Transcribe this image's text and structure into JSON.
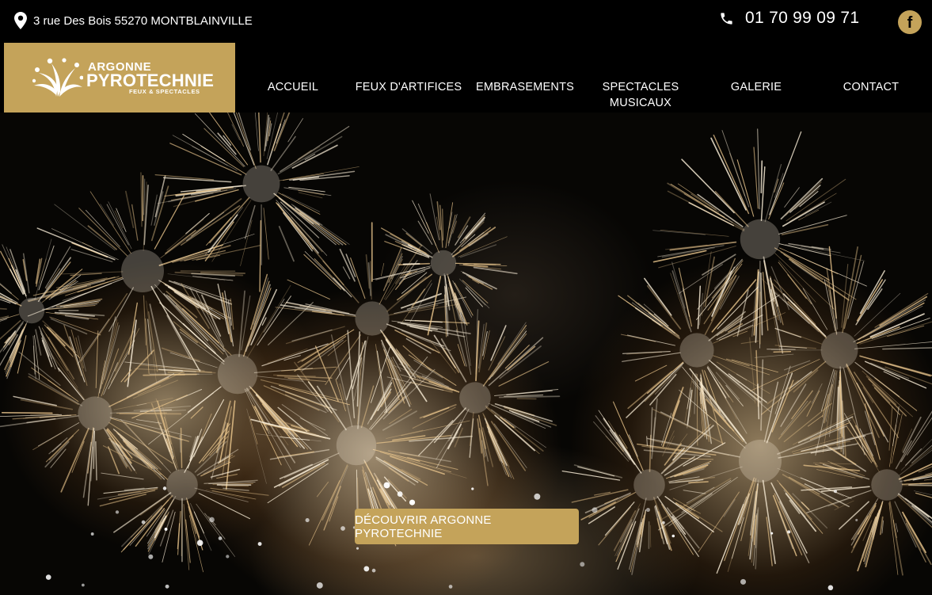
{
  "topbar": {
    "address": "3 rue Des Bois 55270 MONTBLAINVILLE",
    "phone": "01 70 99 09 71",
    "facebook_icon": "facebook-icon"
  },
  "logo": {
    "line1": "ARGONNE",
    "line2": "PYROTECHNIE",
    "line3": "FEUX & SPECTACLES"
  },
  "nav": {
    "items": [
      {
        "label": "ACCUEIL"
      },
      {
        "label": "FEUX D'ARTIFICES"
      },
      {
        "label": "EMBRASEMENTS"
      },
      {
        "label": "SPECTACLES MUSICAUX"
      },
      {
        "label": "GALERIE"
      },
      {
        "label": "CONTACT"
      }
    ]
  },
  "hero": {
    "cta_label": "DÉCOUVRIR ARGONNE PYROTECHNIE"
  },
  "colors": {
    "brand_gold": "#c4a35a",
    "background": "#000000"
  }
}
